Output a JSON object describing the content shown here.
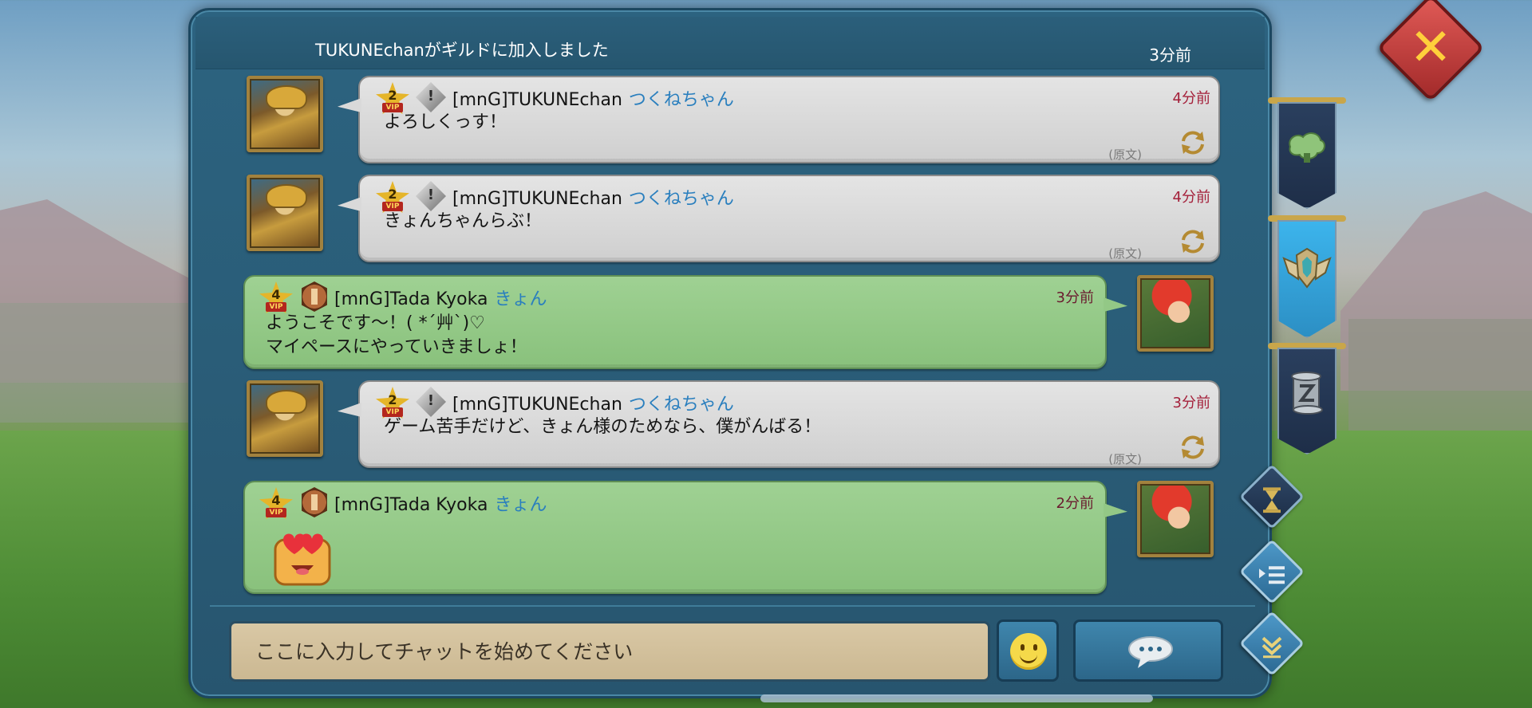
{
  "system": {
    "text": "TUKUNEchanがギルドに加入しました",
    "time": "3分前"
  },
  "messages": [
    {
      "side": "left",
      "vip": "2",
      "vip_tag": "VIP",
      "name": "[mnG]TUKUNEchan",
      "nick": "つくねちゃん",
      "time": "4分前",
      "text": "よろしくっす！",
      "original": "(原文)"
    },
    {
      "side": "left",
      "vip": "2",
      "vip_tag": "VIP",
      "name": "[mnG]TUKUNEchan",
      "nick": "つくねちゃん",
      "time": "4分前",
      "text": "きょんちゃんらぶ！",
      "original": "(原文)"
    },
    {
      "side": "right",
      "vip": "4",
      "vip_tag": "VIP",
      "name": "[mnG]Tada Kyoka",
      "nick": "きょん",
      "time": "3分前",
      "line1": "ようこそです〜！( *´艸`)♡",
      "line2": "マイペースにやっていきましょ！"
    },
    {
      "side": "left",
      "vip": "2",
      "vip_tag": "VIP",
      "name": "[mnG]TUKUNEchan",
      "nick": "つくねちゃん",
      "time": "3分前",
      "text": "ゲーム苦手だけど、きょん様のためなら、僕がんばる！",
      "original": "(原文)"
    },
    {
      "side": "right",
      "vip": "4",
      "vip_tag": "VIP",
      "name": "[mnG]Tada Kyoka",
      "nick": "きょん",
      "time": "2分前",
      "sticker": "heart-eyes-sticker"
    }
  ],
  "input": {
    "placeholder": "ここに入力してチャットを始めてください"
  },
  "icons": {
    "close": "close-icon",
    "emoji": "smiley-icon",
    "send": "speech-bubble-icon",
    "translate": "refresh-icon",
    "side_tabs": [
      "map-icon",
      "guild-crest-icon",
      "scroll-icon"
    ],
    "side_buttons": [
      "hourglass-icon",
      "list-icon",
      "scroll-down-icon"
    ]
  },
  "colors": {
    "panel": "#2a5d78",
    "bubble_gray": "#d9d9d9",
    "bubble_green": "#93c886",
    "nick_blue": "#2a7fbe",
    "time_red": "#a4203a",
    "close_red": "#c0403c",
    "active_tab": "#3cb4ec"
  }
}
